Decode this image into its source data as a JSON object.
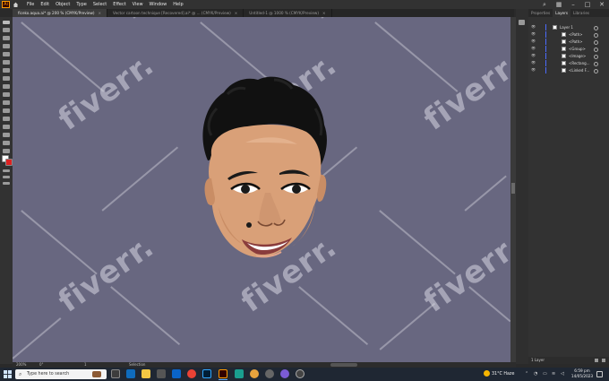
{
  "menubar": {
    "app_icon": "Ai",
    "items": [
      "File",
      "Edit",
      "Object",
      "Type",
      "Select",
      "Effect",
      "View",
      "Window",
      "Help"
    ]
  },
  "tabs": [
    {
      "label": "ficeko.aqua.ai* @ 200 % (CMYK/Preview)",
      "active": true
    },
    {
      "label": "Vector cartoon technique [Recovered].ai* @ ... (CMYK/Preview)",
      "active": false
    },
    {
      "label": "Untitled-1 @ 1000 % (CMYK/Preview)",
      "active": false
    }
  ],
  "layers_panel": {
    "tabs": [
      "Properties",
      "Layers",
      "Libraries"
    ],
    "active_tab": "Layers",
    "rows": [
      "Layer 1",
      "<Path>",
      "<Path>",
      "<Group>",
      "<Image>",
      "<Rectang...",
      "<Linked F..."
    ],
    "layer_count": "1 Layer"
  },
  "statusbar": {
    "zoom": "200%",
    "angle": "0°",
    "page": "1",
    "tool": "Selection"
  },
  "taskbar": {
    "search_placeholder": "Type here to search",
    "weather": "31°C  Haze",
    "time": "6:59 pm",
    "date": "14/05/2023"
  },
  "watermark": "fiverr.",
  "colors": {
    "canvas": "#686780",
    "skin": "#d9a078",
    "hair": "#111111",
    "accent": "#4b6bff"
  }
}
